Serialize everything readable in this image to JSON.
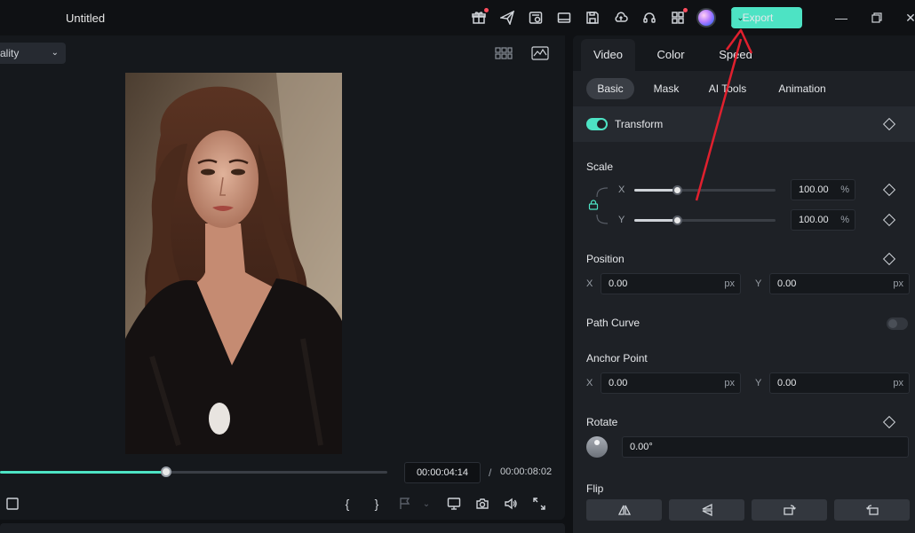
{
  "app": {
    "title": "Untitled"
  },
  "toolbar": {
    "icons": [
      "gift-icon",
      "send-icon",
      "history-icon",
      "layout-icon",
      "save-icon",
      "cloud-upload-icon",
      "headset-icon",
      "apps-icon",
      "avatar"
    ],
    "export_label": "Export"
  },
  "preview": {
    "quality_label": "ality",
    "current_time": "00:00:04:14",
    "separator": "/",
    "total_time": "00:00:08:02",
    "progress": 0.43
  },
  "props": {
    "main_tabs": [
      {
        "label": "Video"
      },
      {
        "label": "Color"
      },
      {
        "label": "Speed"
      }
    ],
    "sub_tabs": [
      {
        "label": "Basic"
      },
      {
        "label": "Mask"
      },
      {
        "label": "AI Tools"
      },
      {
        "label": "Animation"
      }
    ],
    "transform": {
      "label": "Transform",
      "enabled": true
    },
    "scale": {
      "label": "Scale",
      "x_label": "X",
      "x_value": "100.00",
      "x_unit": "%",
      "x_level": 0.3,
      "y_label": "Y",
      "y_value": "100.00",
      "y_unit": "%",
      "y_level": 0.3
    },
    "position": {
      "label": "Position",
      "x_label": "X",
      "x_value": "0.00",
      "x_unit": "px",
      "y_label": "Y",
      "y_value": "0.00",
      "y_unit": "px"
    },
    "path_curve": {
      "label": "Path Curve",
      "enabled": false
    },
    "anchor": {
      "label": "Anchor Point",
      "x_label": "X",
      "x_value": "0.00",
      "x_unit": "px",
      "y_label": "Y",
      "y_value": "0.00",
      "y_unit": "px"
    },
    "rotate": {
      "label": "Rotate",
      "value": "0.00°"
    },
    "flip": {
      "label": "Flip"
    }
  },
  "colors": {
    "accent": "#4de3c4",
    "annotation": "#e0202e",
    "background": "#0f1114",
    "panel": "#1e2126"
  }
}
